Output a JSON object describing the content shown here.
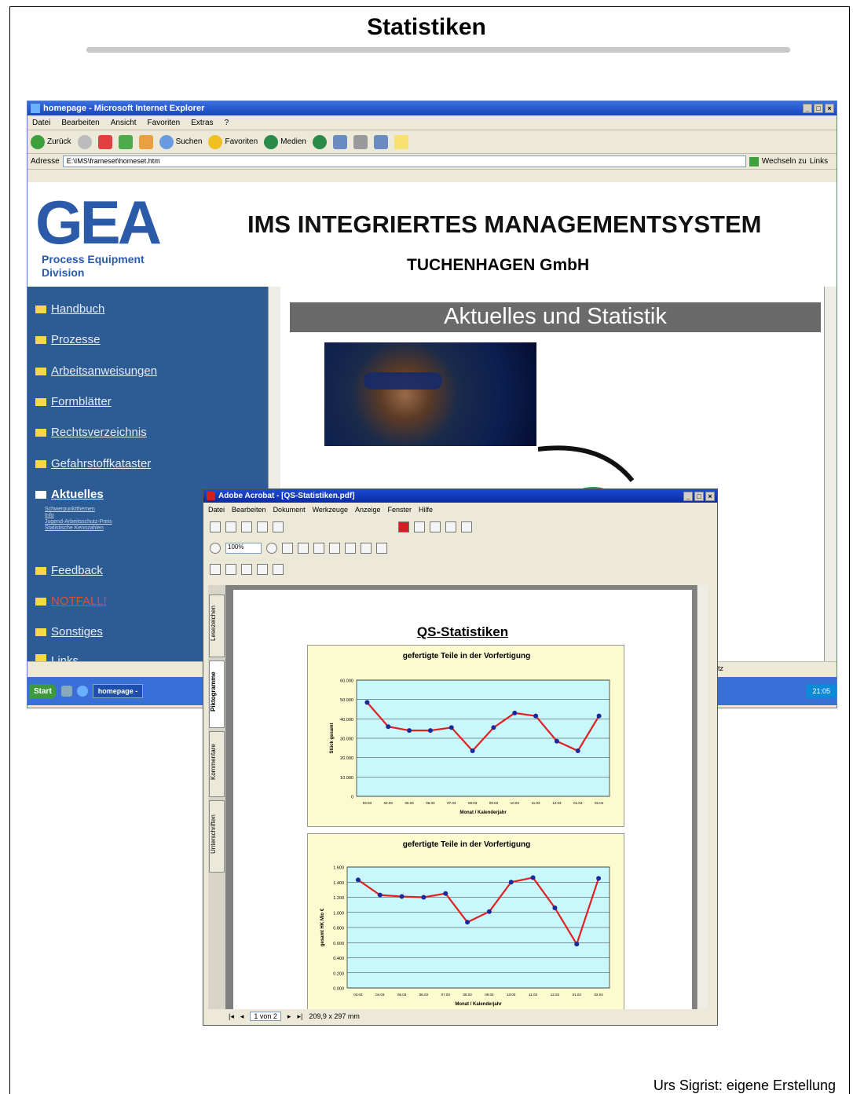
{
  "slide": {
    "title": "Statistiken",
    "credit": "Urs Sigrist: eigene Erstellung"
  },
  "ie": {
    "window_title": "homepage - Microsoft Internet Explorer",
    "menu": [
      "Datei",
      "Bearbeiten",
      "Ansicht",
      "Favoriten",
      "Extras",
      "?"
    ],
    "toolbar": {
      "back": "Zurück",
      "search": "Suchen",
      "favorites": "Favoriten",
      "media": "Medien"
    },
    "address_label": "Adresse",
    "address_value": "E:\\IMS\\frameset\\homeset.htm",
    "go_label": "Wechseln zu",
    "links_label": "Links",
    "status_right": "latz",
    "start_label": "Start",
    "task_label": "homepage -",
    "clock": "21:05"
  },
  "site": {
    "logo_text": "GEA",
    "logo_sub": "Process Equipment Division",
    "title": "IMS INTEGRIERTES MANAGEMENTSYSTEM",
    "subtitle": "TUCHENHAGEN GmbH",
    "banner": "Aktuelles und Statistik",
    "nav": [
      "Handbuch",
      "Prozesse",
      "Arbeitsanweisungen",
      "Formblätter",
      "Rechtsverzeichnis",
      "Gefahrstoffkataster",
      "Aktuelles",
      "Feedback",
      "NOTFALL!",
      "Sonstiges",
      "Links"
    ],
    "nav_sub": [
      "Schwerpunktthemen",
      "Info",
      "Jugend-Arbeitsschutz-Preis",
      "Statistische Kennzahlen"
    ]
  },
  "acrobat": {
    "window_title": "Adobe Acrobat - [QS-Statistiken.pdf]",
    "menu": [
      "Datei",
      "Bearbeiten",
      "Dokument",
      "Werkzeuge",
      "Anzeige",
      "Fenster",
      "Hilfe"
    ],
    "zoom": "100%",
    "side_tabs": [
      "Lesezeichen",
      "Piktogramme",
      "Kommentare",
      "Unterschriften"
    ],
    "page_indicator": "1 von 2",
    "page_size": "209,9 x 297 mm"
  },
  "pdf": {
    "title": "QS-Statistiken"
  },
  "chart_data": [
    {
      "type": "line",
      "title": "gefertigte Teile in der Vorfertigung",
      "xlabel": "Monat / Kalenderjahr",
      "ylabel": "Stück gesamt",
      "ylim": [
        0,
        60000
      ],
      "yticks": [
        "0",
        "10.000",
        "20.000",
        "30.000",
        "40.000",
        "50.000",
        "60.000"
      ],
      "categories": [
        "03.03",
        "04.03",
        "05.03",
        "06.03",
        "07.03",
        "08.03",
        "09.03",
        "10.03",
        "11.03",
        "12.03",
        "01.04",
        "02.04"
      ],
      "series": [
        {
          "values": [
            48500,
            36000,
            34000,
            34000,
            35500,
            23500,
            35500,
            43000,
            41500,
            28500,
            23500,
            41500
          ]
        }
      ],
      "grid": true,
      "colors": {
        "line": "#e02020",
        "marker": "#1a2a9a",
        "plot_bg": "#c8f8fc"
      }
    },
    {
      "type": "line",
      "title": "gefertigte Teile in der Vorfertigung",
      "xlabel": "Monat / Kalenderjahr",
      "ylabel": "gesamt HK Mio €",
      "ylim": [
        0,
        1.6
      ],
      "yticks": [
        "0.000",
        "0.200",
        "0.400",
        "0.600",
        "0.800",
        "1.000",
        "1.200",
        "1.400",
        "1.600"
      ],
      "categories": [
        "03.03",
        "04.03",
        "05.03",
        "06.03",
        "07.03",
        "08.03",
        "09.03",
        "10.03",
        "11.03",
        "12.03",
        "01.04",
        "02.04"
      ],
      "series": [
        {
          "values": [
            1.43,
            1.23,
            1.21,
            1.2,
            1.25,
            0.87,
            1.01,
            1.4,
            1.46,
            1.06,
            0.58,
            1.45
          ]
        }
      ],
      "grid": true,
      "colors": {
        "line": "#e02020",
        "marker": "#1a2a9a",
        "plot_bg": "#c8f8fc"
      }
    }
  ]
}
